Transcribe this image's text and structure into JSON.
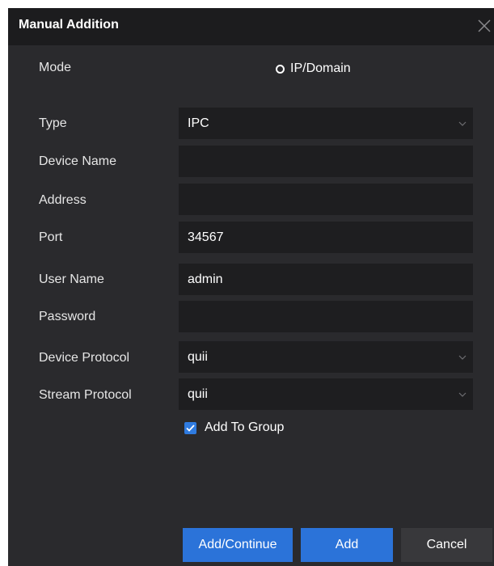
{
  "dialog": {
    "title": "Manual Addition"
  },
  "mode": {
    "label": "Mode",
    "option": "IP/Domain"
  },
  "fields": {
    "type": {
      "label": "Type",
      "value": "IPC"
    },
    "device_name": {
      "label": "Device Name",
      "value": ""
    },
    "address": {
      "label": "Address",
      "value": ""
    },
    "port": {
      "label": "Port",
      "value": "34567"
    },
    "user_name": {
      "label": "User Name",
      "value": "admin"
    },
    "password": {
      "label": "Password",
      "value": ""
    },
    "device_protocol": {
      "label": "Device Protocol",
      "value": "quii"
    },
    "stream_protocol": {
      "label": "Stream Protocol",
      "value": "quii"
    }
  },
  "add_to_group": {
    "label": "Add To Group",
    "checked": true
  },
  "buttons": {
    "add_continue": "Add/Continue",
    "add": "Add",
    "cancel": "Cancel"
  },
  "icons": {
    "close": "close-icon",
    "dropdown": "chevron-down-icon",
    "check": "check-icon"
  },
  "colors": {
    "background": "#2a2a2d",
    "titlebar": "#1c1c1e",
    "field": "#1e1e20",
    "accent": "#2b73d9"
  }
}
